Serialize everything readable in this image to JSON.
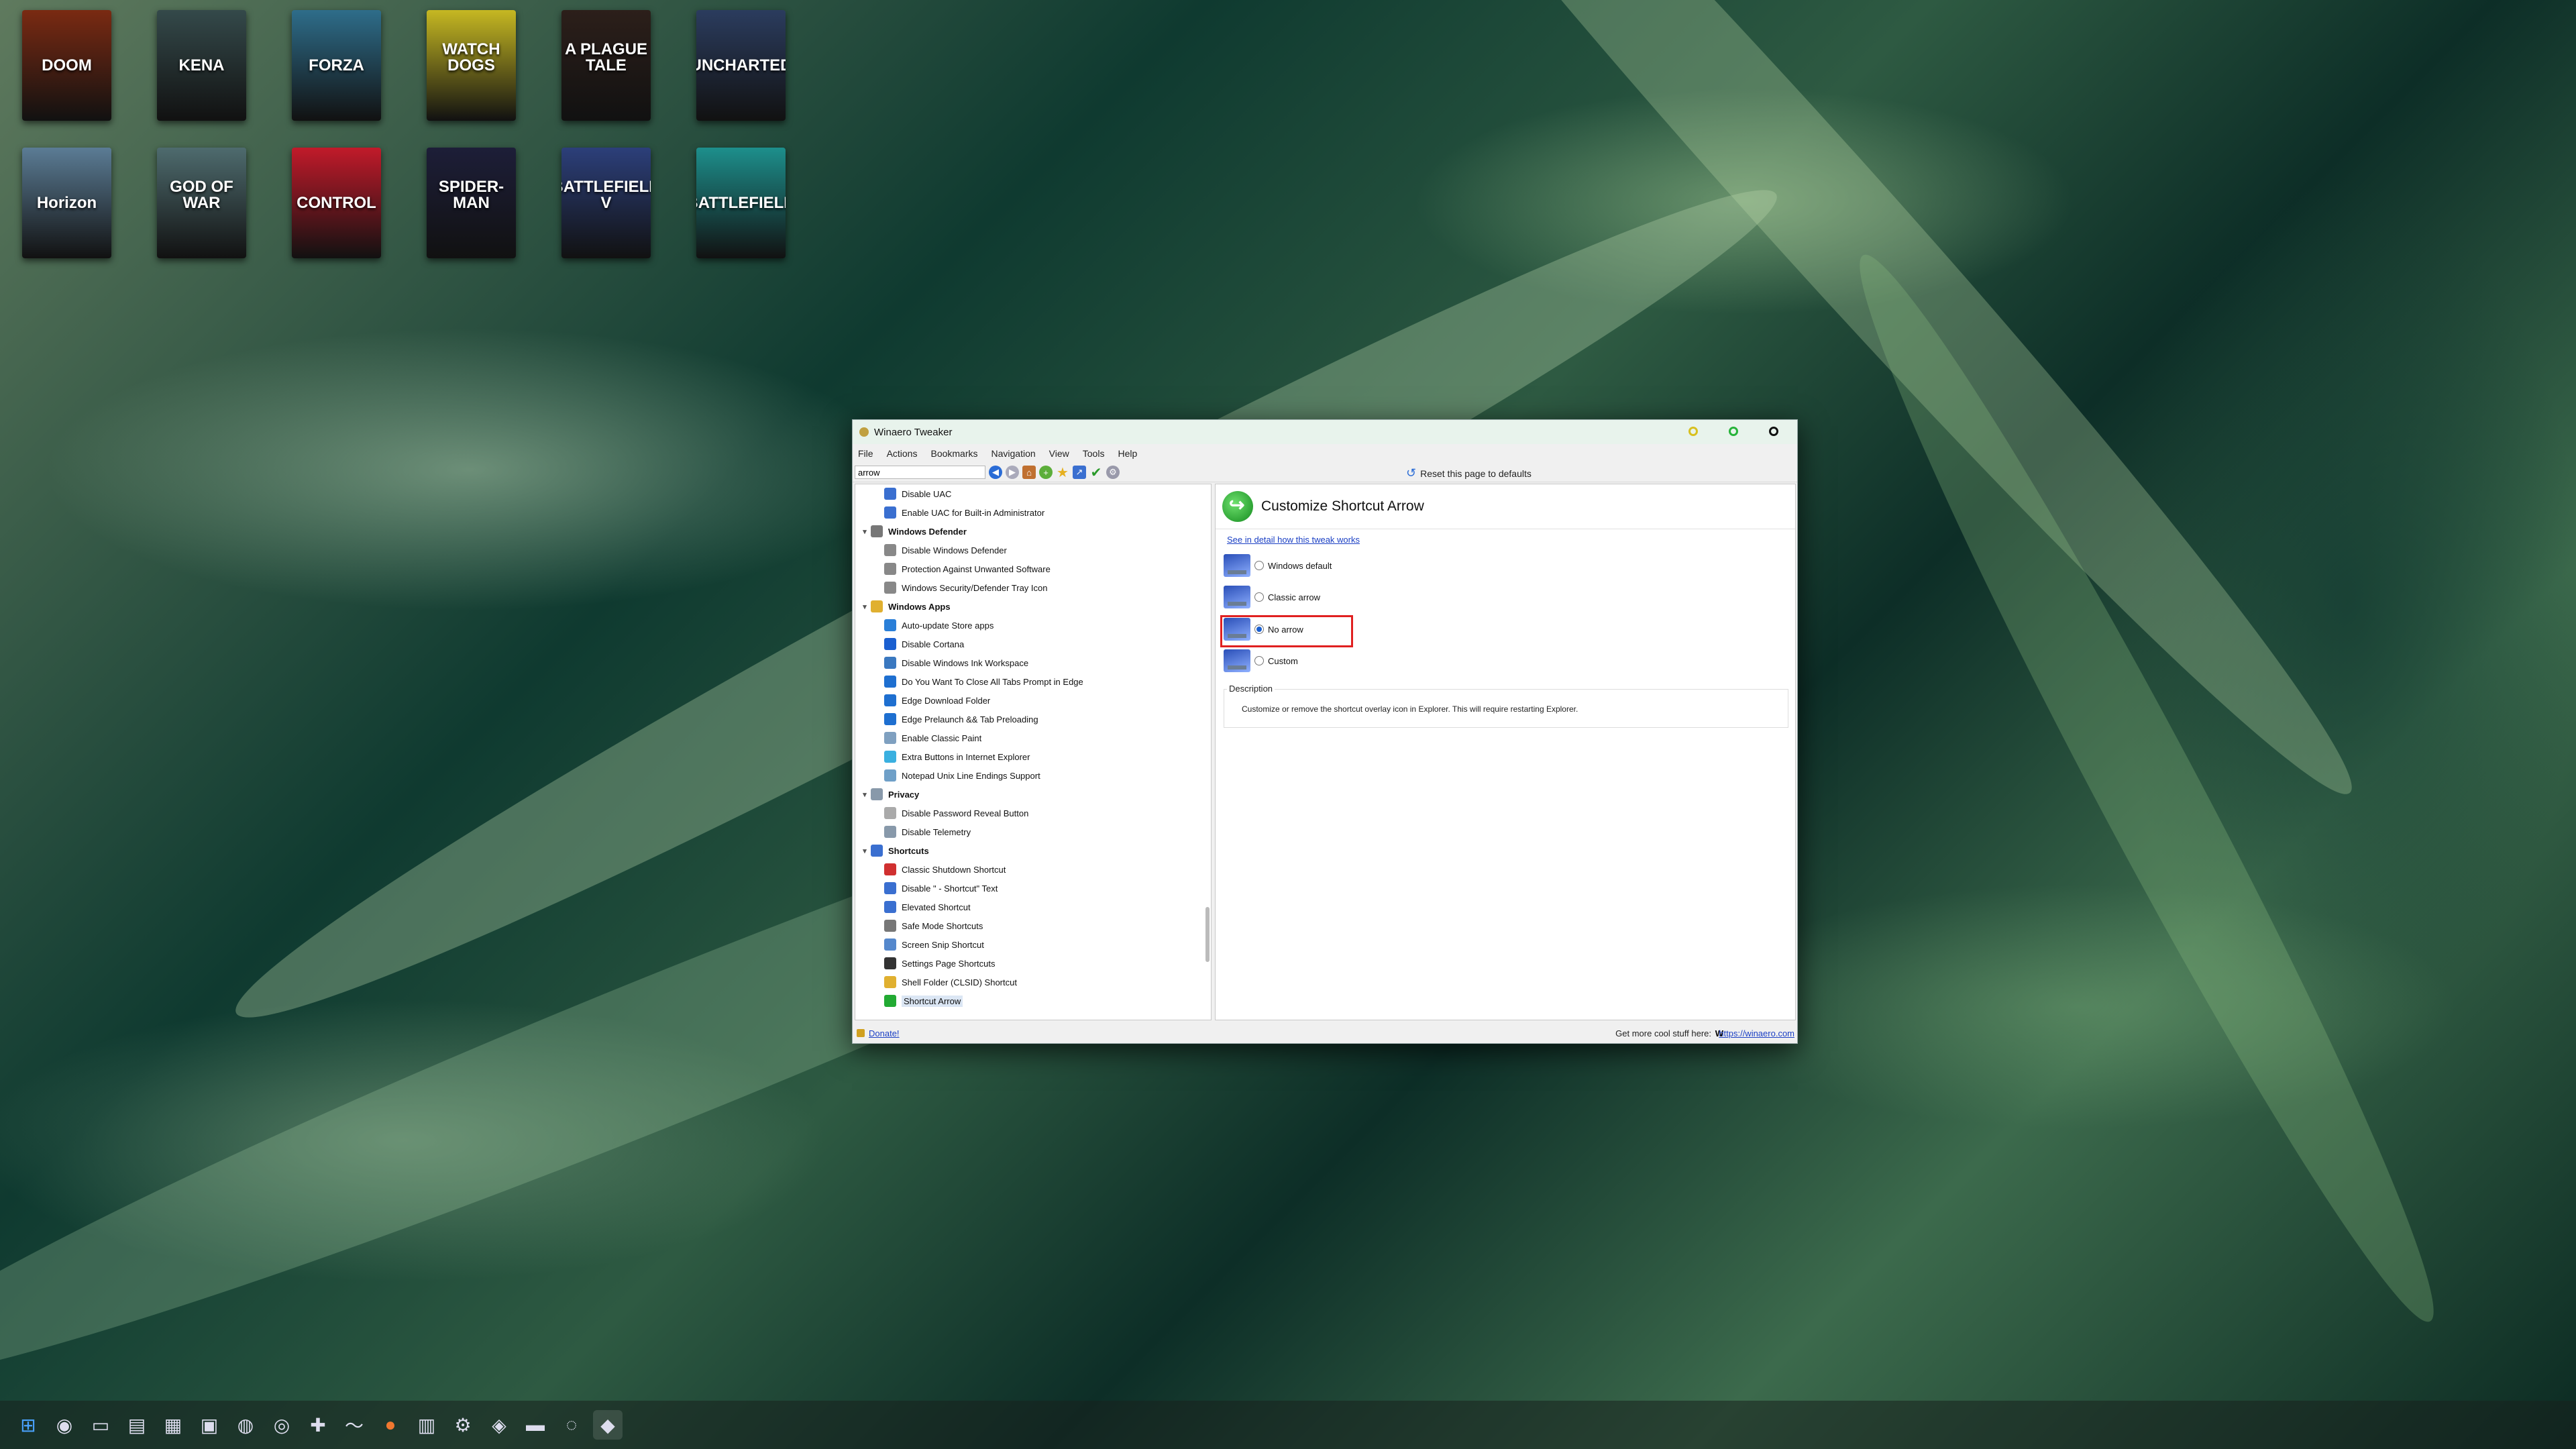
{
  "desktop": {
    "icons": [
      {
        "label": "DOOM",
        "bg": "#7a2a12"
      },
      {
        "label": "KENA",
        "bg": "#34494a"
      },
      {
        "label": "FORZA",
        "bg": "#2e6d8a"
      },
      {
        "label": "WATCH DOGS",
        "bg": "#c6b822"
      },
      {
        "label": "A PLAGUE TALE",
        "bg": "#2c1f1a"
      },
      {
        "label": "UNCHARTED",
        "bg": "#2b3c5e"
      },
      {
        "label": "Horizon",
        "bg": "#5b7c95"
      },
      {
        "label": "GOD OF WAR",
        "bg": "#4e6b6e"
      },
      {
        "label": "CONTROL",
        "bg": "#c11a2a"
      },
      {
        "label": "SPIDER-MAN",
        "bg": "#1d1e38"
      },
      {
        "label": "BATTLEFIELD V",
        "bg": "#2c3f7a"
      },
      {
        "label": "BATTLEFIELD",
        "bg": "#1d8f8c"
      }
    ]
  },
  "window": {
    "title": "Winaero Tweaker",
    "menu": [
      "File",
      "Actions",
      "Bookmarks",
      "Navigation",
      "View",
      "Tools",
      "Help"
    ],
    "search_value": "arrow",
    "reset_label": "Reset this page to defaults",
    "tree": [
      {
        "label": "Disable UAC",
        "type": "item",
        "icon_color": "#3a6fd0"
      },
      {
        "label": "Enable UAC for Built-in Administrator",
        "type": "item",
        "icon_color": "#3a6fd0"
      },
      {
        "label": "Windows Defender",
        "type": "cat",
        "icon_color": "#777777"
      },
      {
        "label": "Disable Windows Defender",
        "type": "item",
        "icon_color": "#888888"
      },
      {
        "label": "Protection Against Unwanted Software",
        "type": "item",
        "icon_color": "#888888"
      },
      {
        "label": "Windows Security/Defender Tray Icon",
        "type": "item",
        "icon_color": "#888888"
      },
      {
        "label": "Windows Apps",
        "type": "cat",
        "icon_color": "#e0b030"
      },
      {
        "label": "Auto-update Store apps",
        "type": "item",
        "icon_color": "#2a7fd8"
      },
      {
        "label": "Disable Cortana",
        "type": "item",
        "icon_color": "#1a5fd0"
      },
      {
        "label": "Disable Windows Ink Workspace",
        "type": "item",
        "icon_color": "#3a78c0"
      },
      {
        "label": "Do You Want To Close All Tabs Prompt in Edge",
        "type": "item",
        "icon_color": "#1e6fd0"
      },
      {
        "label": "Edge Download Folder",
        "type": "item",
        "icon_color": "#1e6fd0"
      },
      {
        "label": "Edge Prelaunch && Tab Preloading",
        "type": "item",
        "icon_color": "#1e6fd0"
      },
      {
        "label": "Enable Classic Paint",
        "type": "item",
        "icon_color": "#7fa0c0"
      },
      {
        "label": "Extra Buttons in Internet Explorer",
        "type": "item",
        "icon_color": "#3ab0e0"
      },
      {
        "label": "Notepad Unix Line Endings Support",
        "type": "item",
        "icon_color": "#6fa0c8"
      },
      {
        "label": "Privacy",
        "type": "cat",
        "icon_color": "#8899aa"
      },
      {
        "label": "Disable Password Reveal Button",
        "type": "item",
        "icon_color": "#aaaaaa"
      },
      {
        "label": "Disable Telemetry",
        "type": "item",
        "icon_color": "#8899aa"
      },
      {
        "label": "Shortcuts",
        "type": "cat",
        "icon_color": "#3a6fd0"
      },
      {
        "label": "Classic Shutdown Shortcut",
        "type": "item",
        "icon_color": "#d03030"
      },
      {
        "label": "Disable \" - Shortcut\" Text",
        "type": "item",
        "icon_color": "#3a6fd0"
      },
      {
        "label": "Elevated Shortcut",
        "type": "item",
        "icon_color": "#3a6fd0"
      },
      {
        "label": "Safe Mode Shortcuts",
        "type": "item",
        "icon_color": "#777777"
      },
      {
        "label": "Screen Snip Shortcut",
        "type": "item",
        "icon_color": "#5588cc"
      },
      {
        "label": "Settings Page Shortcuts",
        "type": "item",
        "icon_color": "#333333"
      },
      {
        "label": "Shell Folder (CLSID) Shortcut",
        "type": "item",
        "icon_color": "#e0b030"
      },
      {
        "label": "Shortcut Arrow",
        "type": "item",
        "icon_color": "#22aa33",
        "selected": true
      }
    ],
    "page_title": "Customize Shortcut Arrow",
    "detail_link": "See in detail how this tweak works",
    "options": [
      {
        "label": "Windows default",
        "checked": false
      },
      {
        "label": "Classic arrow",
        "checked": false
      },
      {
        "label": "No arrow",
        "checked": true
      },
      {
        "label": "Custom",
        "checked": false
      }
    ],
    "description_header": "Description",
    "description_text": "Customize or remove the shortcut overlay icon in Explorer. This will require restarting Explorer.",
    "status": {
      "donate": "Donate!",
      "more": "Get more cool stuff here:",
      "url": "https://winaero.com"
    }
  },
  "taskbar": {
    "icons": [
      "start-icon",
      "edge-icon",
      "file-explorer-icon",
      "terminal-icon",
      "clapper-icon",
      "notes-icon",
      "browser-icon",
      "obs-icon",
      "gamepad-icon",
      "steam-icon",
      "orange-app-icon",
      "utility-icon",
      "gear-icon",
      "torrent-icon",
      "monitor-icon",
      "chrome-icon",
      "winaero-icon"
    ]
  },
  "colors": {
    "accent": "#1a5fd0",
    "highlight_box": "#e02020"
  }
}
